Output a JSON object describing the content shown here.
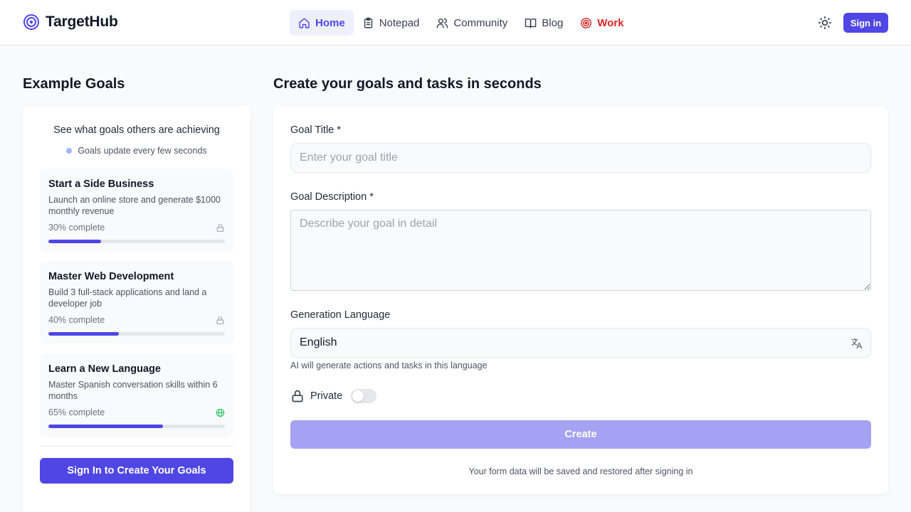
{
  "header": {
    "brand": "TargetHub",
    "nav": [
      {
        "label": "Home",
        "icon": "home-icon"
      },
      {
        "label": "Notepad",
        "icon": "clipboard-icon"
      },
      {
        "label": "Community",
        "icon": "users-icon"
      },
      {
        "label": "Blog",
        "icon": "book-icon"
      },
      {
        "label": "Work",
        "icon": "target-icon"
      }
    ],
    "sign_in": "Sign in"
  },
  "examples": {
    "title": "Example Goals",
    "subtitle": "See what goals others are achieving",
    "note": "Goals update every few seconds",
    "goals": [
      {
        "title": "Start a Side Business",
        "description": "Launch an online store and generate $1000 monthly revenue",
        "progress_text": "30% complete",
        "progress": 30,
        "visibility_icon": "lock-icon"
      },
      {
        "title": "Master Web Development",
        "description": "Build 3 full-stack applications and land a developer job",
        "progress_text": "40% complete",
        "progress": 40,
        "visibility_icon": "lock-icon"
      },
      {
        "title": "Learn a New Language",
        "description": "Master Spanish conversation skills within 6 months",
        "progress_text": "65% complete",
        "progress": 65,
        "visibility_icon": "globe-icon"
      }
    ],
    "cta": "Sign In to Create Your Goals"
  },
  "form": {
    "title": "Create your goals and tasks in seconds",
    "goal_title_label": "Goal Title *",
    "goal_title_placeholder": "Enter your goal title",
    "goal_title_value": "",
    "goal_desc_label": "Goal Description *",
    "goal_desc_placeholder": "Describe your goal in detail",
    "goal_desc_value": "",
    "language_label": "Generation Language",
    "language_value": "English",
    "language_helper": "AI will generate actions and tasks in this language",
    "private_label": "Private",
    "private_on": false,
    "create_label": "Create",
    "footnote": "Your form data will be saved and restored after signing in"
  },
  "colors": {
    "accent": "#4f46e5",
    "accent_disabled": "#a5a1f3",
    "work": "#dc2626",
    "public": "#22c55e"
  }
}
